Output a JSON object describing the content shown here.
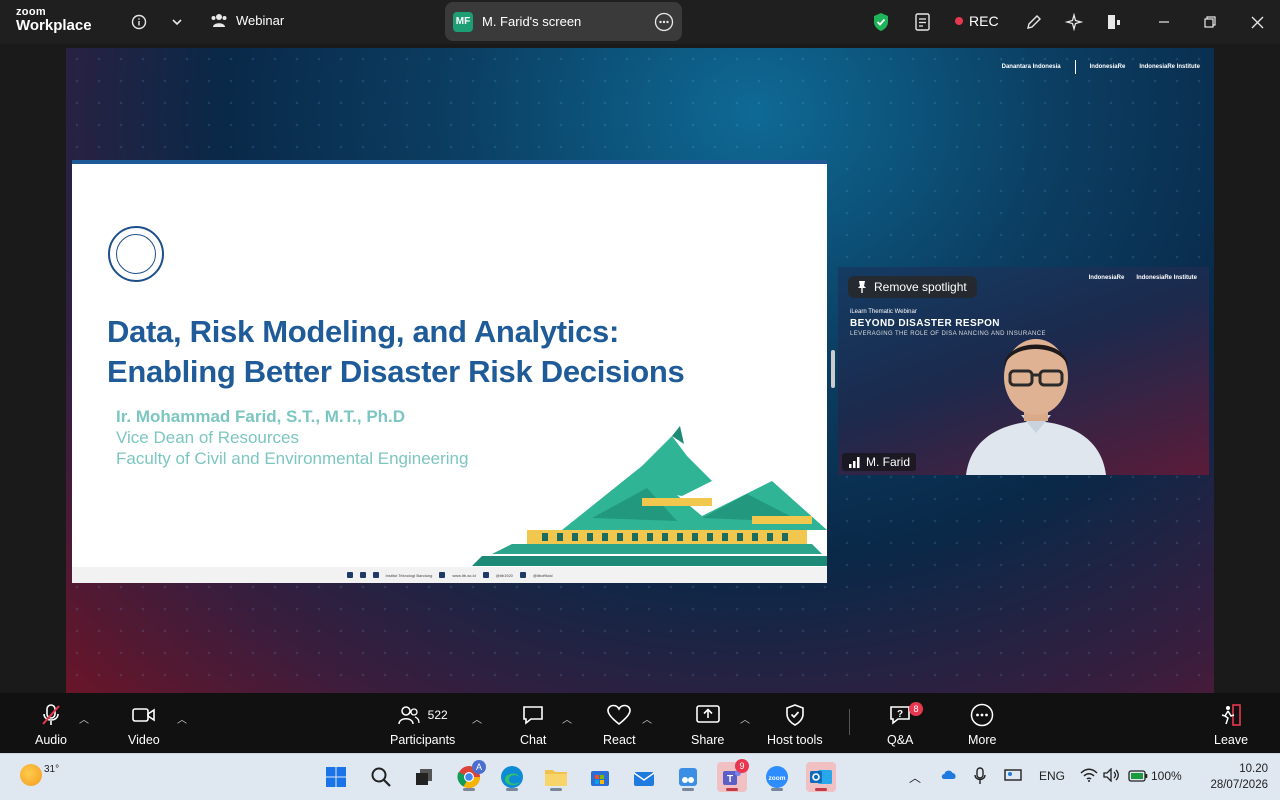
{
  "topbar": {
    "logo_line1": "zoom",
    "logo_line2": "Workplace",
    "webinar_label": "Webinar",
    "screen_initials": "MF",
    "screen_label": "M. Farid's screen",
    "rec_label": "REC"
  },
  "stage": {
    "brand_top_left": "Danantara Indonesia",
    "brand_top_mid": "IndonesiaRe",
    "brand_top_right": "IndonesiaRe Institute"
  },
  "slide": {
    "title_line1": "Data, Risk Modeling, and Analytics:",
    "title_line2": "Enabling Better Disaster Risk Decisions",
    "presenter_name": "Ir. Mohammad Farid, S.T., M.T., Ph.D",
    "presenter_role": "Vice Dean of Resources",
    "presenter_faculty": "Faculty of Civil and Environmental Engineering",
    "footer_org": "Institut Teknologi Bandung",
    "footer_web": "www.itb.ac.id",
    "footer_handle": "@itb1920",
    "footer_handle2": "@itbofficial"
  },
  "video": {
    "spotlight_label": "Remove spotlight",
    "brand1": "IndonesiaRe",
    "brand2": "IndonesiaRe Institute",
    "small_caption": "iLearn Thematic Webinar",
    "headline": "BEYOND DISASTER RESPON",
    "subline": "LEVERAGING THE ROLE OF DISA          NANCING AND INSURANCE",
    "participant_name": "M. Farid"
  },
  "toolbar": {
    "audio": "Audio",
    "video": "Video",
    "participants": "Participants",
    "participants_count": "522",
    "chat": "Chat",
    "react": "React",
    "share": "Share",
    "host_tools": "Host tools",
    "qa": "Q&A",
    "qa_badge": "8",
    "more": "More",
    "leave": "Leave"
  },
  "taskbar": {
    "temperature": "31°",
    "teams_badge": "9",
    "chrome_badge": "A",
    "language": "ENG",
    "battery": "100%",
    "time": "10.20",
    "date": "28/07/2026"
  },
  "colors": {
    "slide_title": "#1f5b99",
    "presenter_text": "#7cc6c1",
    "rec_dot": "#e8384f",
    "shield_green": "#1fb35a"
  }
}
